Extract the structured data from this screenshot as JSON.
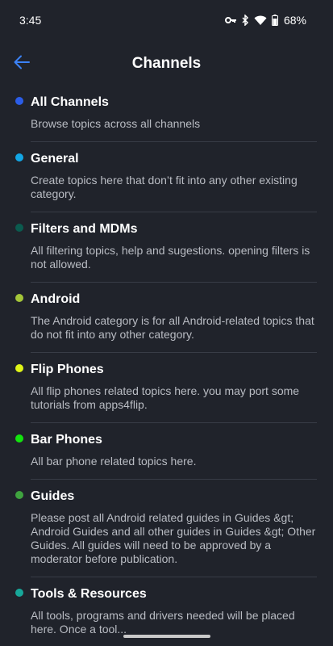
{
  "status_bar": {
    "time": "3:45",
    "battery": "68%",
    "icons": [
      "vpn-key-icon",
      "bluetooth-icon",
      "wifi-icon",
      "battery-icon"
    ]
  },
  "header": {
    "title": "Channels",
    "back_icon": "arrow-left-icon"
  },
  "colors": {
    "background": "#20232b",
    "accent": "#3b82f6",
    "divider": "#383c46"
  },
  "channels": [
    {
      "name": "All Channels",
      "description": "Browse topics across all channels",
      "color": "#2b5de8"
    },
    {
      "name": "General",
      "description": "Create topics here that don’t fit into any other existing category.",
      "color": "#12a6e5"
    },
    {
      "name": "Filters and MDMs",
      "description": "All filtering topics, help and sugestions. opening filters is not allowed.",
      "color": "#0b5b4f"
    },
    {
      "name": "Android",
      "description": "The Android category is for all Android-related topics that do not fit into any other category.",
      "color": "#a4c639"
    },
    {
      "name": "Flip Phones",
      "description": "All flip phones related topics here. you may port some tutorials from apps4flip.",
      "color": "#e0f518"
    },
    {
      "name": "Bar Phones",
      "description": "All bar phone related topics here.",
      "color": "#13e30e"
    },
    {
      "name": "Guides",
      "description": "Please post all Android related guides in Guides &gt; Android Guides and all other guides in Guides &gt; Other Guides. All guides will need to be approved by a moderator before publication.",
      "color": "#3fa33f"
    },
    {
      "name": "Tools & Resources",
      "description": "All tools, programs and drivers needed will be placed here. Once a tool...",
      "color": "#17a89a"
    }
  ]
}
